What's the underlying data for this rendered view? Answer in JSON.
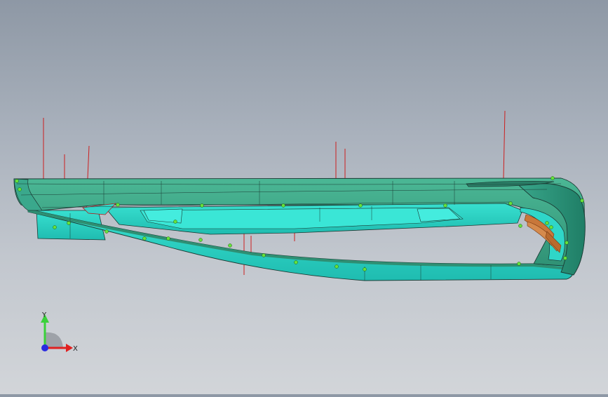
{
  "view": {
    "background_top": "#8e98a5",
    "background_bottom": "#d2d5d9",
    "model_face_color": "#2fd6c8",
    "model_top_color": "#3aa88c",
    "edge_color": "#1a3a33",
    "highlight_color": "#c8773a",
    "marker_color": "#66e23a",
    "leader_color": "#cc1f1f"
  },
  "triad": {
    "y_label": "Y",
    "x_label": "X",
    "y_color": "#3ad13a",
    "x_color": "#e02020",
    "z_color": "#2a2ae0"
  }
}
